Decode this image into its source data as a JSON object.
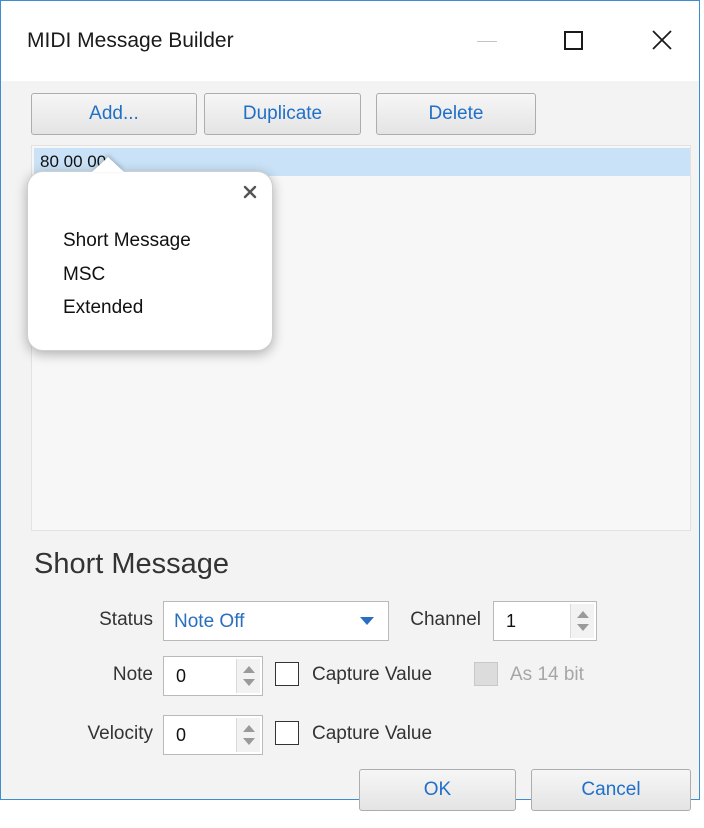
{
  "window": {
    "title": "MIDI Message Builder"
  },
  "toolbar": {
    "add_label": "Add...",
    "duplicate_label": "Duplicate",
    "delete_label": "Delete"
  },
  "message_list": {
    "items": [
      "80 00 00"
    ]
  },
  "type_menu": {
    "items": [
      "Short Message",
      "MSC",
      "Extended"
    ]
  },
  "short_message": {
    "section_title": "Short Message",
    "status_label": "Status",
    "status_value": "Note Off",
    "channel_label": "Channel",
    "channel_value": "1",
    "note_label": "Note",
    "note_value": "0",
    "note_capture_label": "Capture Value",
    "note_capture_checked": false,
    "as14bit_label": "As 14 bit",
    "as14bit_enabled": false,
    "velocity_label": "Velocity",
    "velocity_value": "0",
    "velocity_capture_label": "Capture Value",
    "velocity_capture_checked": false
  },
  "footer": {
    "ok_label": "OK",
    "cancel_label": "Cancel"
  },
  "colors": {
    "accent": "#2070c8",
    "selection": "#c9e2f7",
    "window_border": "#3c8dd1"
  },
  "icons": {
    "minimize": "minimize-icon",
    "maximize": "maximize-icon",
    "close": "close-icon",
    "popover_close": "close-icon",
    "dropdown": "chevron-down-icon",
    "spinner": "spinner-icon"
  }
}
